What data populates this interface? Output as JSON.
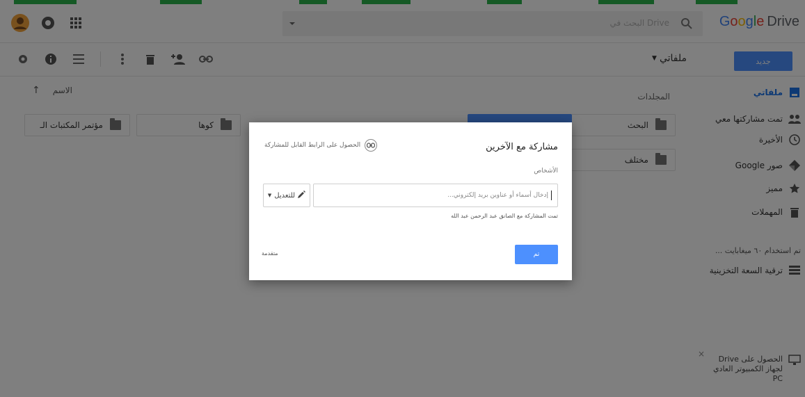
{
  "header": {
    "logo_word": "Google",
    "logo_product": "Drive",
    "search_placeholder": "البحث في Drive"
  },
  "toolbar": {
    "new_button": "جديد",
    "my_files": "ملفاتي"
  },
  "sidebar": {
    "items": [
      {
        "label": "ملفاتي",
        "icon": "drive-icon",
        "active": true
      },
      {
        "label": "تمت مشاركتها معي",
        "icon": "people-icon",
        "active": false
      },
      {
        "label": "الأخيرة",
        "icon": "clock-icon",
        "active": false
      },
      {
        "label": "صور Google",
        "icon": "photos-icon",
        "active": false
      },
      {
        "label": "مميز",
        "icon": "star-icon",
        "active": false
      },
      {
        "label": "المهملات",
        "icon": "trash-icon",
        "active": false
      }
    ],
    "storage_used": "تم استخدام ٦٠ ميغابايت ...",
    "upgrade_storage": "ترقية السعة التخزينية",
    "promo_line1": "الحصول على Drive",
    "promo_line2": "لجهاز الكمبيوتر العادي",
    "promo_line3": "PC"
  },
  "main": {
    "sort_label": "الاسم",
    "folders_label": "المجلدات",
    "folders": [
      "البحث",
      "مختلف",
      "كوها",
      "مؤتمر المكتبات الـ"
    ]
  },
  "dialog": {
    "title": "مشاركة مع الآخرين",
    "get_link": "الحصول على الرابط القابل للمشاركة",
    "people_label": "الأشخاص",
    "input_placeholder": "إدخال أسماء أو عناوين بريد إلكتروني...",
    "permission": "للتعديل",
    "shared_note": "تمت المشاركة مع الصانق عبد الرحمن عبد الله",
    "done_button": "تم",
    "advanced": "متقدمة"
  },
  "colors": {
    "accent": "#4d90fe",
    "active_nav": "#1a73e8",
    "overlay": "rgba(0,0,0,0.5)"
  }
}
